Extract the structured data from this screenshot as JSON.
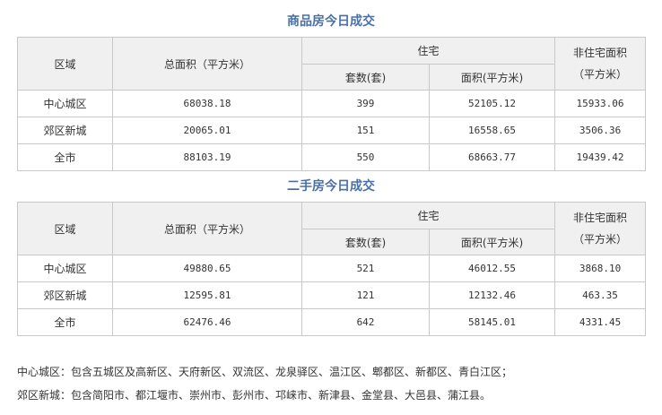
{
  "section1": {
    "title": "商品房今日成交",
    "headers": {
      "region": "区域",
      "total_area": "总面积（平方米）",
      "residential": "住宅",
      "units": "套数(套)",
      "res_area": "面积(平方米)",
      "nonres_line1": "非住宅面积",
      "nonres_line2": "（平方米）"
    },
    "rows": [
      {
        "region": "中心城区",
        "total_area": "68038.18",
        "units": "399",
        "res_area": "52105.12",
        "nonres": "15933.06"
      },
      {
        "region": "郊区新城",
        "total_area": "20065.01",
        "units": "151",
        "res_area": "16558.65",
        "nonres": "3506.36"
      },
      {
        "region": "全市",
        "total_area": "88103.19",
        "units": "550",
        "res_area": "68663.77",
        "nonres": "19439.42"
      }
    ]
  },
  "section2": {
    "title": "二手房今日成交",
    "headers": {
      "region": "区域",
      "total_area": "总面积（平方米）",
      "residential": "住宅",
      "units": "套数(套)",
      "res_area": "面积(平方米)",
      "nonres_line1": "非住宅面积",
      "nonres_line2": "（平方米）"
    },
    "rows": [
      {
        "region": "中心城区",
        "total_area": "49880.65",
        "units": "521",
        "res_area": "46012.55",
        "nonres": "3868.10"
      },
      {
        "region": "郊区新城",
        "total_area": "12595.81",
        "units": "121",
        "res_area": "12132.46",
        "nonres": "463.35"
      },
      {
        "region": "全市",
        "total_area": "62476.46",
        "units": "642",
        "res_area": "58145.01",
        "nonres": "4331.45"
      }
    ]
  },
  "notes": {
    "central": "中心城区：包含五城区及高新区、天府新区、双流区、龙泉驿区、温江区、郫都区、新都区、青白江区；",
    "suburban": "郊区新城：包含简阳市、都江堰市、崇州市、彭州市、邛崃市、新津县、金堂县、大邑县、蒲江县。"
  }
}
